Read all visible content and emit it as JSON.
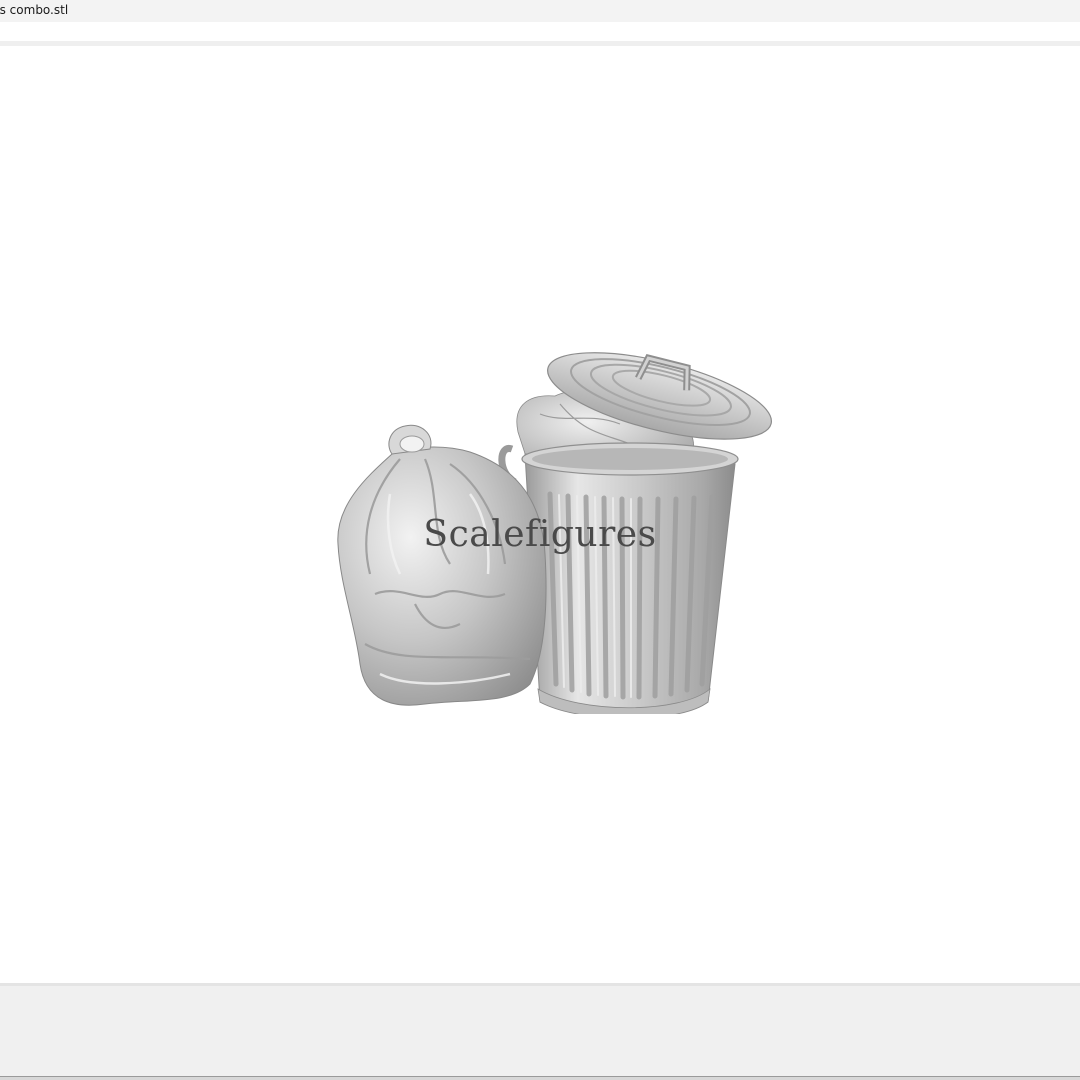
{
  "window": {
    "title": "gs combo.stl"
  },
  "viewport": {
    "watermark": "Scalefigures",
    "model_icon": "trash-can-and-garbage-bag-3d-model"
  },
  "colors": {
    "titlebar": "#f3f3f3",
    "viewport_background": "#ffffff",
    "statusbar": "#f0f0f0",
    "model_gray": "#c8c8c8"
  }
}
